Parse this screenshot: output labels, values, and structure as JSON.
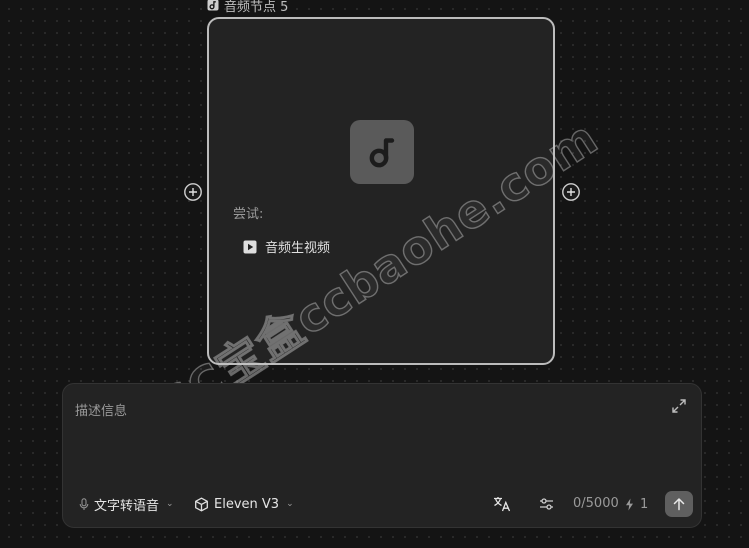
{
  "node": {
    "title": "音频节点 5",
    "title_icon": "music-note-icon",
    "center_icon": "music-note-icon",
    "try_label": "尝试:",
    "suggestion_label": "音频生视频",
    "suggestion_icon": "play-icon",
    "add_icon": "plus-circle-icon"
  },
  "watermark": {
    "text": "CC宝盒ccbaohe.com"
  },
  "prompt": {
    "placeholder": "描述信息",
    "expand_icon": "expand-icon",
    "mode_label": "文字转语音",
    "mode_icon": "microphone-icon",
    "model_label": "Eleven V3",
    "model_icon": "cube-icon",
    "translate_icon": "translate-icon",
    "settings_icon": "sliders-icon",
    "char_count": "0/5000",
    "credit_icon": "lightning-icon",
    "credit_value": "1",
    "send_icon": "arrow-up-icon"
  },
  "colors": {
    "background": "#141414",
    "card": "#232323",
    "card_border": "#bcbcbc",
    "tile": "#5a5a5a",
    "send_button": "#5f5f5f"
  }
}
